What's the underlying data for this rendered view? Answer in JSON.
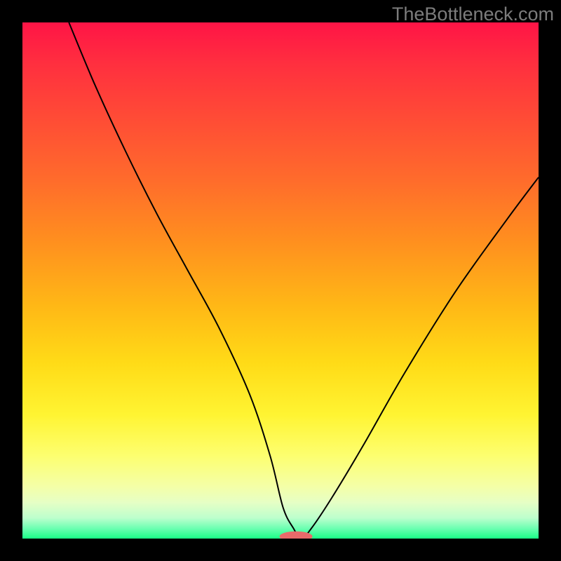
{
  "watermark": "TheBottleneck.com",
  "chart_data": {
    "type": "line",
    "title": "",
    "xlabel": "",
    "ylabel": "",
    "xlim": [
      0,
      100
    ],
    "ylim": [
      0,
      100
    ],
    "series": [
      {
        "name": "bottleneck-curve",
        "x": [
          9,
          14,
          20,
          26,
          32,
          38,
          44,
          48,
          50.5,
          52.5,
          54,
          56,
          60,
          66,
          74,
          84,
          94,
          100
        ],
        "values": [
          100,
          88,
          75,
          63,
          52,
          41,
          28,
          16,
          6,
          2,
          0,
          2,
          8,
          18,
          32,
          48,
          62,
          70
        ]
      }
    ],
    "minimum_marker": {
      "x": 53,
      "y": 0.4,
      "rx": 3.2,
      "ry": 1.0
    },
    "gradient_stops": [
      {
        "pct": 0,
        "color": "#ff1446"
      },
      {
        "pct": 8,
        "color": "#ff2f3f"
      },
      {
        "pct": 18,
        "color": "#ff4a36"
      },
      {
        "pct": 30,
        "color": "#ff6a2c"
      },
      {
        "pct": 42,
        "color": "#ff8e1f"
      },
      {
        "pct": 55,
        "color": "#ffb816"
      },
      {
        "pct": 66,
        "color": "#ffdb17"
      },
      {
        "pct": 76,
        "color": "#fff432"
      },
      {
        "pct": 84,
        "color": "#fdff70"
      },
      {
        "pct": 90,
        "color": "#f4ffa8"
      },
      {
        "pct": 93,
        "color": "#e6ffc5"
      },
      {
        "pct": 96,
        "color": "#bdffcd"
      },
      {
        "pct": 98,
        "color": "#6dffb2"
      },
      {
        "pct": 100,
        "color": "#1aff86"
      }
    ]
  }
}
